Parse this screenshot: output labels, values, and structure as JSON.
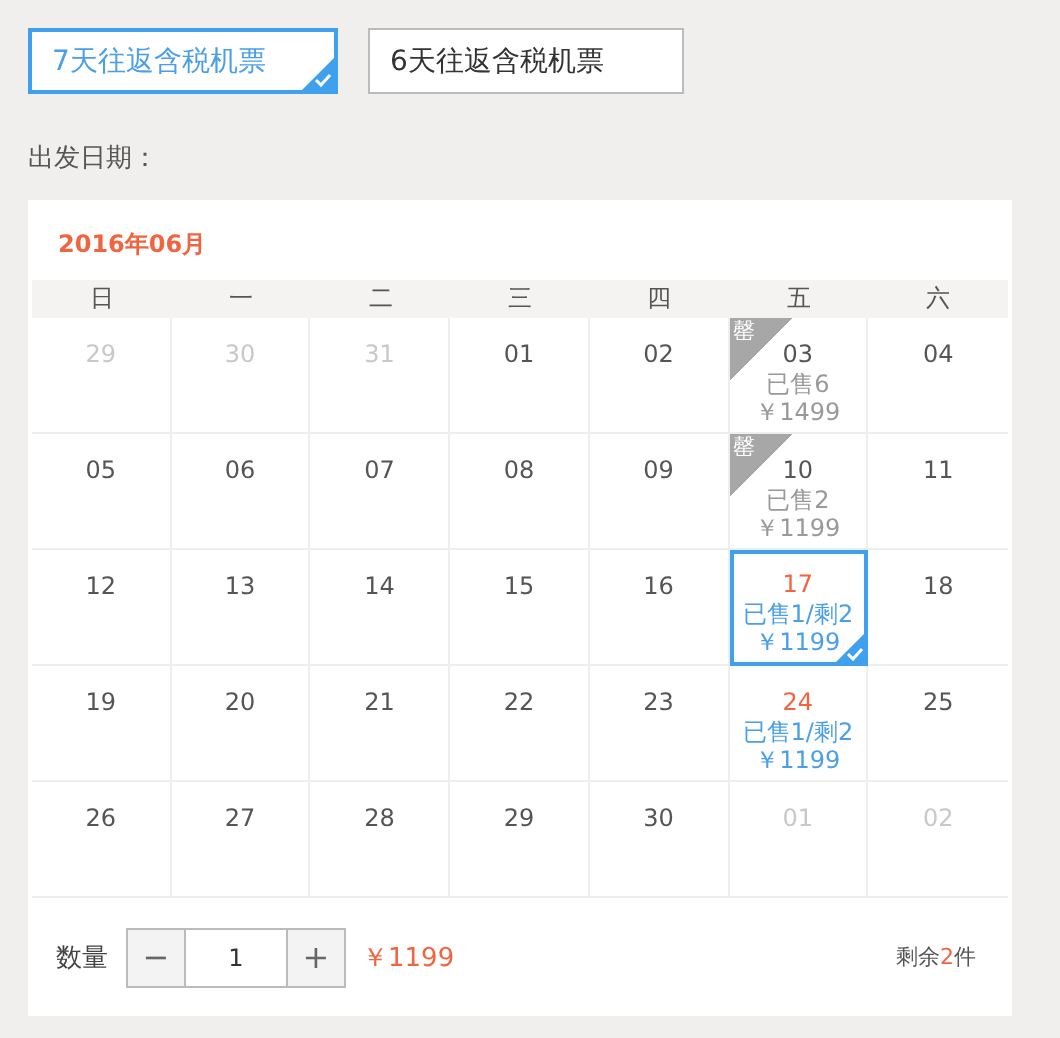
{
  "options": [
    {
      "label": "7天往返含税机票",
      "selected": true
    },
    {
      "label": "6天往返含税机票",
      "selected": false
    }
  ],
  "date_label": "出发日期：",
  "calendar": {
    "title": "2016年06月",
    "weekdays": [
      "日",
      "一",
      "二",
      "三",
      "四",
      "五",
      "六"
    ],
    "weeks": [
      [
        {
          "day": "29",
          "kind": "other-month",
          "selected": false
        },
        {
          "day": "30",
          "kind": "other-month",
          "selected": false
        },
        {
          "day": "31",
          "kind": "other-month",
          "selected": false
        },
        {
          "day": "01",
          "kind": "normal",
          "selected": false
        },
        {
          "day": "02",
          "kind": "normal",
          "selected": false
        },
        {
          "day": "03",
          "kind": "sold-out",
          "badge": "罄",
          "sold": "已售6",
          "price": "￥1499",
          "selected": false
        },
        {
          "day": "04",
          "kind": "normal",
          "selected": false
        }
      ],
      [
        {
          "day": "05",
          "kind": "normal",
          "selected": false
        },
        {
          "day": "06",
          "kind": "normal",
          "selected": false
        },
        {
          "day": "07",
          "kind": "normal",
          "selected": false
        },
        {
          "day": "08",
          "kind": "normal",
          "selected": false
        },
        {
          "day": "09",
          "kind": "normal",
          "selected": false
        },
        {
          "day": "10",
          "kind": "sold-out",
          "badge": "罄",
          "sold": "已售2",
          "price": "￥1199",
          "selected": false
        },
        {
          "day": "11",
          "kind": "normal",
          "selected": false
        }
      ],
      [
        {
          "day": "12",
          "kind": "normal",
          "selected": false
        },
        {
          "day": "13",
          "kind": "normal",
          "selected": false
        },
        {
          "day": "14",
          "kind": "normal",
          "selected": false
        },
        {
          "day": "15",
          "kind": "normal",
          "selected": false
        },
        {
          "day": "16",
          "kind": "normal",
          "selected": false
        },
        {
          "day": "17",
          "kind": "available",
          "sold": "已售1/剩2",
          "price": "￥1199",
          "selected": true
        },
        {
          "day": "18",
          "kind": "normal",
          "selected": false
        }
      ],
      [
        {
          "day": "19",
          "kind": "normal",
          "selected": false
        },
        {
          "day": "20",
          "kind": "normal",
          "selected": false
        },
        {
          "day": "21",
          "kind": "normal",
          "selected": false
        },
        {
          "day": "22",
          "kind": "normal",
          "selected": false
        },
        {
          "day": "23",
          "kind": "normal",
          "selected": false
        },
        {
          "day": "24",
          "kind": "available",
          "sold": "已售1/剩2",
          "price": "￥1199",
          "selected": false
        },
        {
          "day": "25",
          "kind": "normal",
          "selected": false
        }
      ],
      [
        {
          "day": "26",
          "kind": "normal",
          "selected": false
        },
        {
          "day": "27",
          "kind": "normal",
          "selected": false
        },
        {
          "day": "28",
          "kind": "normal",
          "selected": false
        },
        {
          "day": "29",
          "kind": "normal",
          "selected": false
        },
        {
          "day": "30",
          "kind": "normal",
          "selected": false
        },
        {
          "day": "01",
          "kind": "other-month",
          "selected": false
        },
        {
          "day": "02",
          "kind": "other-month",
          "selected": false
        }
      ]
    ]
  },
  "quantity": {
    "label": "数量",
    "minus": "−",
    "value": "1",
    "plus": "+",
    "price": "￥1199"
  },
  "stock": {
    "before": "剩余",
    "count": "2",
    "after": "件"
  }
}
